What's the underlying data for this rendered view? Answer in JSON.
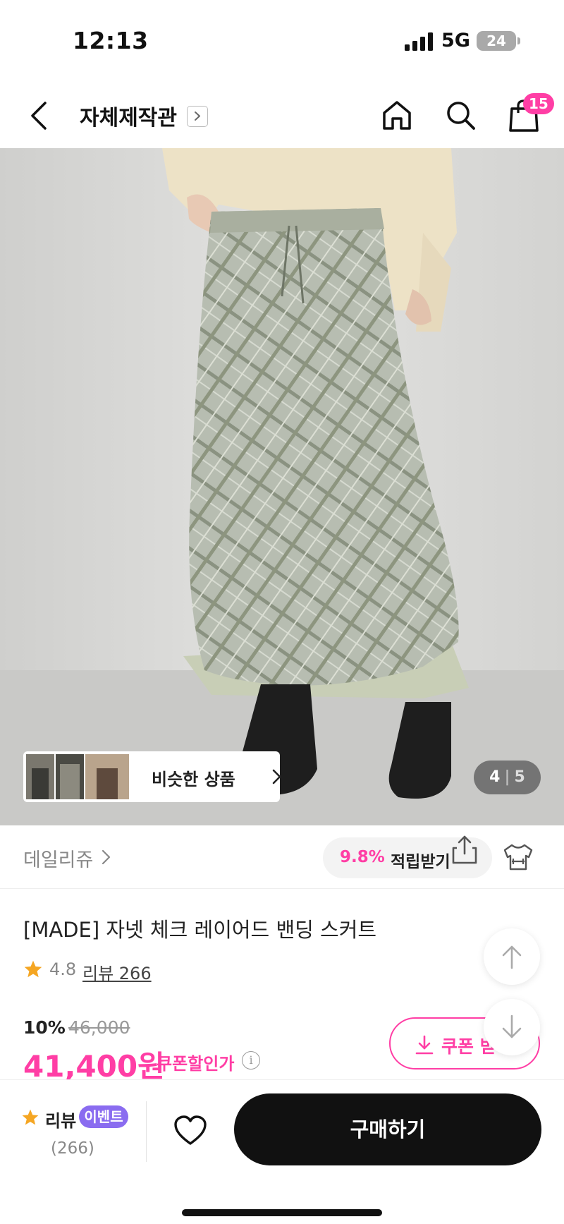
{
  "status_bar": {
    "time": "12:13",
    "network": "5G",
    "battery": "24"
  },
  "nav": {
    "title": "자체제작관",
    "cart_count": "15"
  },
  "gallery": {
    "similar_label": "비슷한 상품",
    "current": "4",
    "separator": "|",
    "total": "5"
  },
  "brand": {
    "name": "데일리쥬",
    "points_percent": "9.8%",
    "points_label": "적립받기"
  },
  "product": {
    "name": "[MADE] 자넷 체크 레이어드 밴딩 스커트",
    "rating": "4.8",
    "review_link": "리뷰 266",
    "discount": "10%",
    "original_price": "46,000",
    "price": "41,400원",
    "price_note": "쿠폰할인가",
    "coupon_label": "쿠폰 받"
  },
  "bottom_bar": {
    "review_label": "리뷰",
    "event_badge": "이벤트",
    "review_count": "(266)",
    "buy_label": "구매하기"
  },
  "colors": {
    "accent": "#ff3ea5",
    "event": "#8a6cf0",
    "buy": "#111111",
    "star": "#f5a623"
  },
  "icons": [
    "back-icon",
    "chevron-right-icon",
    "home-icon",
    "search-icon",
    "shopping-bag-icon",
    "share-icon",
    "fit-icon",
    "star-icon",
    "arrow-up-icon",
    "arrow-down-icon",
    "download-icon",
    "info-icon",
    "heart-icon"
  ]
}
